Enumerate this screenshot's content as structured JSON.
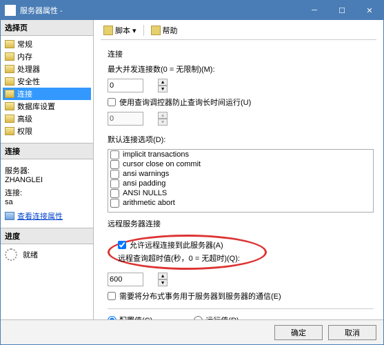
{
  "title": "服务器属性 -",
  "sidebar": {
    "select_head": "选择页",
    "items": [
      "常规",
      "内存",
      "处理器",
      "安全性",
      "连接",
      "数据库设置",
      "高级",
      "权限"
    ],
    "selected_index": 4,
    "conn_head": "连接",
    "server_lbl": "服务器:",
    "server_val": "ZHANGLEI",
    "login_lbl": "连接:",
    "login_val": "sa",
    "view_link": "查看连接属性",
    "prog_head": "进度",
    "prog_status": "就绪"
  },
  "toolbar": {
    "script": "脚本",
    "help": "帮助"
  },
  "main": {
    "conn_title": "连接",
    "max_conn_lbl": "最大并发连接数(0 = 无限制)(M):",
    "max_conn_val": "0",
    "governor_lbl": "使用查询调控器防止查询长时间运行(U)",
    "governor_val": "0",
    "defaults_lbl": "默认连接选项(D):",
    "options": [
      "implicit transactions",
      "cursor close on commit",
      "ansi warnings",
      "ansi padding",
      "ANSI NULLS",
      "arithmetic abort"
    ],
    "remote_title": "远程服务器连接",
    "allow_remote_lbl": "允许远程连接到此服务器(A)",
    "timeout_lbl": "远程查询超时值(秒，0 = 无超时)(Q):",
    "timeout_val": "600",
    "dist_trans_lbl": "需要将分布式事务用于服务器到服务器的通信(E)",
    "config_lbl": "配置值(C)",
    "run_lbl": "运行值(R)"
  },
  "footer": {
    "ok": "确定",
    "cancel": "取消"
  }
}
